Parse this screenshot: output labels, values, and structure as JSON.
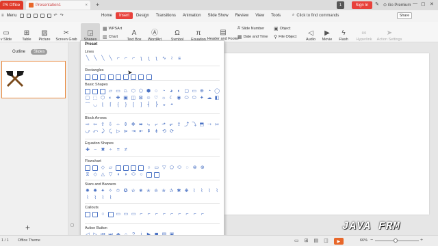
{
  "titlebar": {
    "app_tab": "PS Office",
    "doc_tab": "Presentation1",
    "doc_close": "×",
    "new_tab": "+",
    "counter": "1",
    "sign_in": "Sign In",
    "premium": "Go Premium",
    "accent": "#e03a2a"
  },
  "menubar": {
    "menu_label": "Menu",
    "items": [
      "Home",
      "Insert",
      "Design",
      "Transitions",
      "Animation",
      "Slide Show",
      "Review",
      "View",
      "Tools"
    ],
    "active_item": "Insert",
    "command_search": "Click to find commands",
    "share": "Share"
  },
  "ribbon": {
    "new_slide": "v Slide",
    "table": "Table",
    "picture": "Picture",
    "screen_grab": "Screen Grab",
    "shapes": "Shapes",
    "wpsart_small": "WPSArt",
    "chart": "Chart",
    "text_box": "Text Box",
    "wordart": "WordArt",
    "symbol": "Symbol",
    "equation": "Equation",
    "header_footer": "Header and Footer",
    "slide_number": "Slide Number",
    "date_time": "Date and Time",
    "object": "Object",
    "file_object": "File Object",
    "audio": "Audio",
    "movie": "Movie",
    "flash": "Flash",
    "hyperlink": "Hyperlink",
    "action_settings": "Action Settings"
  },
  "left_panel": {
    "tab_outline": "Outline",
    "tab_slides": "Slides",
    "slide_number": "1",
    "add_slide": "+"
  },
  "shapes_dropdown": {
    "preset": "Preset",
    "categories": [
      {
        "name": "Lines",
        "rows": [
          [
            "╲",
            "╲",
            "╲",
            "╲",
            "⌐",
            "⌐",
            "⌐",
            "ʅ",
            "ʅ",
            "ʅ",
            "∿",
            "≀",
            "ɕ"
          ]
        ]
      },
      {
        "name": "Rectangles",
        "rows": [
          [
            "box",
            "box",
            "box",
            "box",
            "box",
            "box",
            "box",
            "box",
            "box"
          ]
        ]
      },
      {
        "name": "Basic Shapes",
        "rows": [
          [
            "box",
            "box",
            "box",
            "▱",
            "▭",
            "⏢",
            "⬡",
            "⬠",
            "⬢",
            "○",
            "◔",
            "◕",
            "◐",
            "▢",
            "▭",
            "⊕",
            "◔",
            "◯"
          ],
          [
            "▢",
            "⬚",
            "⬡",
            "◐",
            "✚",
            "▣",
            "◫",
            "⊠",
            "☺",
            "♡",
            "☼",
            "☾",
            "◉",
            "⬭",
            "⬭",
            "✦",
            "☁",
            "◧"
          ],
          [
            "⌒",
            "◡",
            "⌊",
            "⌈",
            "{",
            "}",
            "[",
            "]",
            "⎨",
            "⎬",
            "◒",
            "◓"
          ]
        ]
      },
      {
        "name": "Block Arrows",
        "rows": [
          [
            "⇨",
            "⇦",
            "⇧",
            "⇩",
            "⇔",
            "⇕",
            "✥",
            "⬌",
            "⤷",
            "⤶",
            "⬏",
            "⬐",
            "⇪",
            "⤴",
            "⤵",
            "⬒",
            "⇾",
            "⇰"
          ],
          [
            "⤻",
            "⤺",
            "⤸",
            "⤹",
            "▷",
            "⊳",
            "⇥",
            "⇤",
            "⇞",
            "⇟",
            "⟲",
            "⟳"
          ]
        ]
      },
      {
        "name": "Equation Shapes",
        "rows": [
          [
            "✚",
            "−",
            "✖",
            "÷",
            "=",
            "≠"
          ]
        ]
      },
      {
        "name": "Flowchart",
        "rows": [
          [
            "box",
            "box",
            "◇",
            "▱",
            "box",
            "box",
            "box",
            "box",
            "○",
            "▭",
            "▽",
            "⬠",
            "⬭",
            "◌",
            "⊗",
            "⊕"
          ],
          [
            "⧖",
            "◇",
            "△",
            "▽",
            "◖",
            "◗",
            "⬭",
            "○",
            "box",
            "box"
          ]
        ]
      },
      {
        "name": "Stars and Banners",
        "rows": [
          [
            "✹",
            "✸",
            "✦",
            "✧",
            "✩",
            "✪",
            "✫",
            "✬",
            "✭",
            "✮",
            "✯",
            "✰",
            "✱",
            "❋",
            "⌇",
            "⌇",
            "⌇",
            "⌇"
          ],
          [
            "⌇",
            "⌇",
            "⌇",
            "⌇"
          ]
        ]
      },
      {
        "name": "Callouts",
        "rows": [
          [
            "box",
            "box",
            "○",
            "box",
            "▭",
            "▭",
            "▭",
            "⌐",
            "⌐",
            "⌐",
            "⌐",
            "⌐",
            "⌐",
            "⌐",
            "⌐",
            "⌐"
          ]
        ]
      },
      {
        "name": "Action Button",
        "rows": [
          [
            "◁",
            "▷",
            "⏮",
            "⏭",
            "⏏",
            "⌂",
            "?",
            "i",
            "▶",
            "◼",
            "▤",
            "▣"
          ]
        ]
      }
    ]
  },
  "statusbar": {
    "slide_of": "1 / 1",
    "theme": "Office Theme",
    "play": "▶",
    "zoom": "66%",
    "zoom_minus": "−",
    "zoom_plus": "+"
  },
  "watermark": "JAVA FRM"
}
